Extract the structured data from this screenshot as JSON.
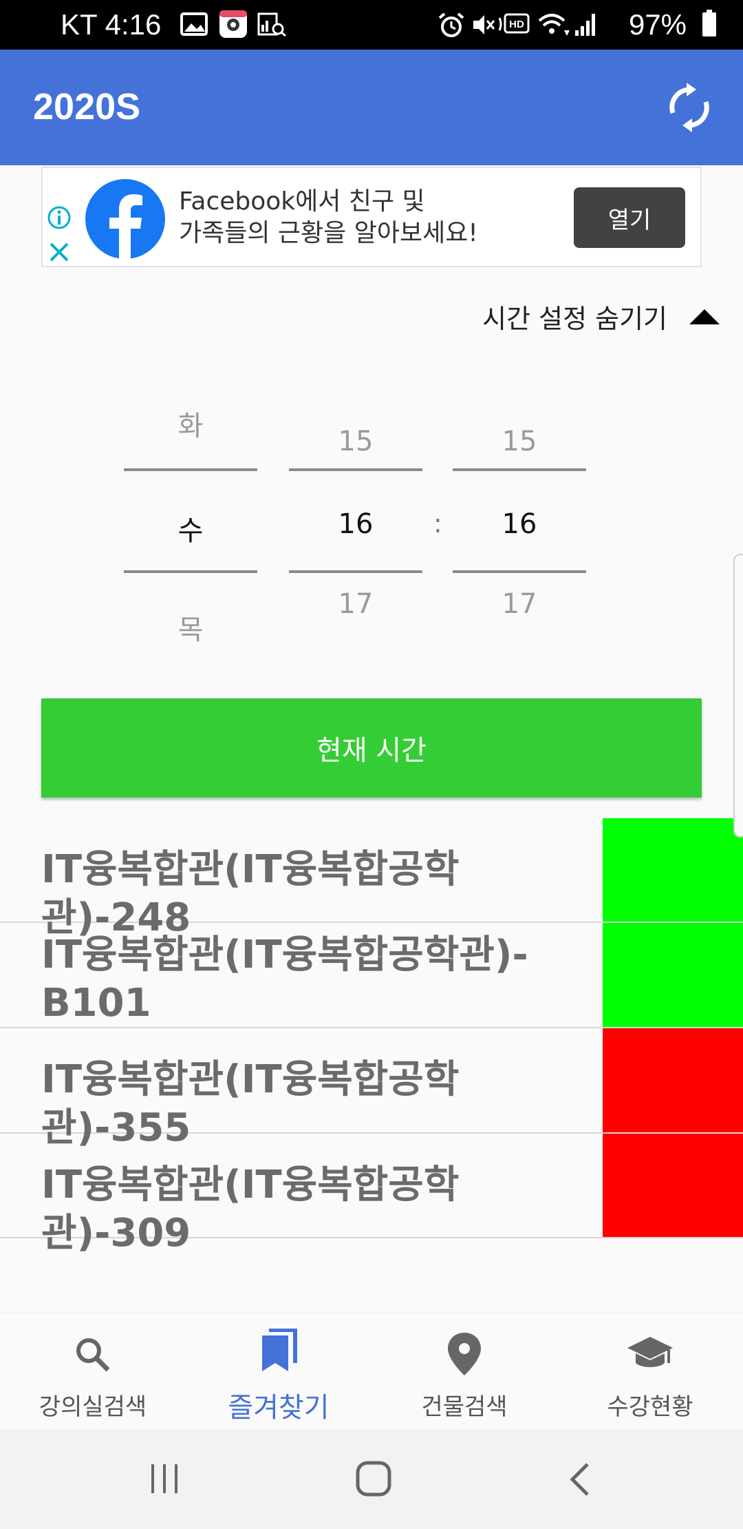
{
  "status_bar": {
    "carrier_time": "KT 4:16",
    "battery": "97%"
  },
  "app_bar": {
    "title": "2020S",
    "refresh_icon": "refresh-icon"
  },
  "ad": {
    "line1": "Facebook에서 친구 및",
    "line2": "가족들의 근황을 알아보세요!",
    "open_label": "열기"
  },
  "time_settings": {
    "toggle_label": "시간 설정 숨기기",
    "day": {
      "prev": "화",
      "current": "수",
      "next": "목"
    },
    "hour": {
      "prev": "15",
      "current": "16",
      "next": "17"
    },
    "separator": ":",
    "minute": {
      "prev": "15",
      "current": "16",
      "next": "17"
    },
    "now_button": "현재 시간"
  },
  "rooms": [
    {
      "line1": "IT융복합관(IT융복합공학관)-248",
      "line2": "",
      "status_color": "#00ff00"
    },
    {
      "line1": "IT융복합관(IT융복합공학관)-",
      "line2": "B101",
      "status_color": "#00ff00"
    },
    {
      "line1": "IT융복합관(IT융복합공학관)-355",
      "line2": "",
      "status_color": "#ff0000"
    },
    {
      "line1": "IT융복합관(IT융복합공학관)-309",
      "line2": "",
      "status_color": "#ff0000"
    }
  ],
  "bottom_nav": [
    {
      "label": "강의실검색",
      "icon": "search-icon"
    },
    {
      "label": "즐겨찾기",
      "icon": "bookmark-icon",
      "active": true
    },
    {
      "label": "건물검색",
      "icon": "location-pin-icon"
    },
    {
      "label": "수강현황",
      "icon": "graduation-cap-icon"
    }
  ],
  "colors": {
    "primary": "#4472d8",
    "button_green": "#35cd35",
    "available": "#00ff00",
    "occupied": "#ff0000"
  }
}
